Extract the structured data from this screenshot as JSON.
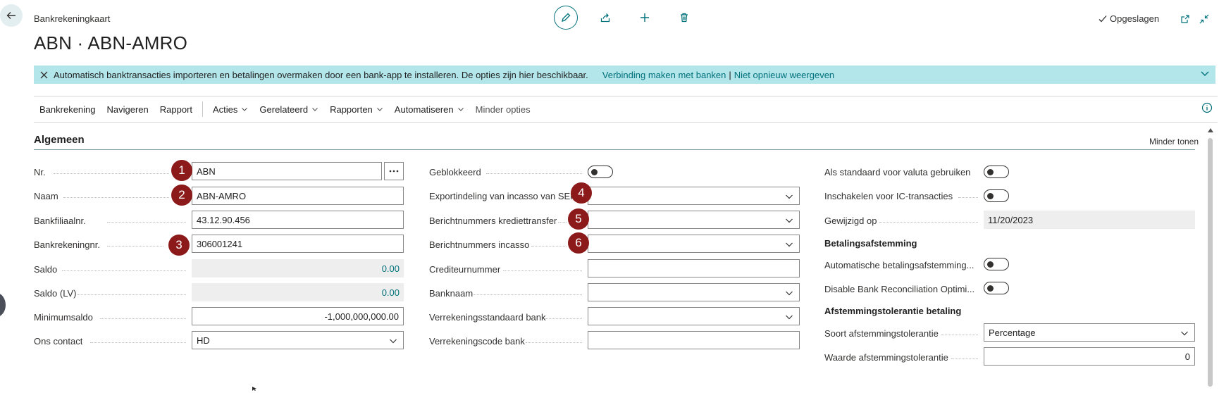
{
  "header": {
    "caption": "Bankrekeningkaart",
    "title": "ABN · ABN-AMRO",
    "saved_label": "Opgeslagen"
  },
  "icons": {
    "back": "arrow-left-icon",
    "edit": "pencil-icon",
    "share": "share-icon",
    "new": "plus-icon",
    "delete": "trash-icon",
    "saved": "checkmark-icon",
    "open_new_window": "open-in-new-window-icon",
    "collapse": "collapse-icon"
  },
  "banner": {
    "message": "Automatisch banktransacties importeren en betalingen overmaken door een bank-app te installeren. De opties zijn hier beschikbaar.",
    "link1": "Verbinding maken met banken",
    "separator": "|",
    "link2": "Niet opnieuw weergeven",
    "color": "#b3e6ea"
  },
  "actionbar": {
    "items": [
      "Bankrekening",
      "Navigeren",
      "Rapport",
      "Acties",
      "Gerelateerd",
      "Rapporten",
      "Automatiseren",
      "Minder opties"
    ]
  },
  "section": {
    "title": "Algemeen",
    "toggle_label": "Minder tonen"
  },
  "col1": {
    "nr": {
      "label": "Nr.",
      "value": "ABN"
    },
    "naam": {
      "label": "Naam",
      "value": "ABN-AMRO"
    },
    "bankfiliaal": {
      "label": "Bankfiliaalnr.",
      "value": "43.12.90.456"
    },
    "bankrekening": {
      "label": "Bankrekeningnr.",
      "value": "306001241"
    },
    "saldo": {
      "label": "Saldo",
      "value": "0.00"
    },
    "saldo_lv": {
      "label": "Saldo (LV)",
      "value": "0.00"
    },
    "minimumsaldo": {
      "label": "Minimumsaldo",
      "value": "-1,000,000,000.00"
    },
    "ons_contact": {
      "label": "Ons contact",
      "value": "HD"
    }
  },
  "col2": {
    "geblokkeerd": {
      "label": "Geblokkeerd"
    },
    "export_sepa": {
      "label": "Exportindeling van incasso van SEPA",
      "value": ""
    },
    "krediettransfer": {
      "label": "Berichtnummers krediettransfer",
      "value": ""
    },
    "incasso": {
      "label": "Berichtnummers incasso",
      "value": ""
    },
    "crediteurnummer": {
      "label": "Crediteurnummer",
      "value": ""
    },
    "banknaam": {
      "label": "Banknaam",
      "value": ""
    },
    "verrekeningsstandaard": {
      "label": "Verrekeningsstandaard bank",
      "value": ""
    },
    "verrekeningscode": {
      "label": "Verrekeningscode bank",
      "value": ""
    }
  },
  "col3": {
    "valuta": {
      "label": "Als standaard voor valuta gebruiken"
    },
    "ic": {
      "label": "Inschakelen voor IC-transacties"
    },
    "gewijzigd": {
      "label": "Gewijzigd op",
      "value": "11/20/2023"
    },
    "group1": "Betalingsafstemming",
    "auto_afstemming": {
      "label": "Automatische betalingsafstemming..."
    },
    "disable_opt": {
      "label": "Disable Bank Reconciliation Optimi..."
    },
    "group2": "Afstemmingstolerantie betaling",
    "soort": {
      "label": "Soort afstemmingstolerantie",
      "value": "Percentage"
    },
    "waarde": {
      "label": "Waarde afstemmingstolerantie",
      "value": "0"
    }
  },
  "markers": [
    "1",
    "2",
    "3",
    "4",
    "5",
    "6"
  ],
  "colors": {
    "accent": "#00707a",
    "marker": "#8c1a1a"
  }
}
